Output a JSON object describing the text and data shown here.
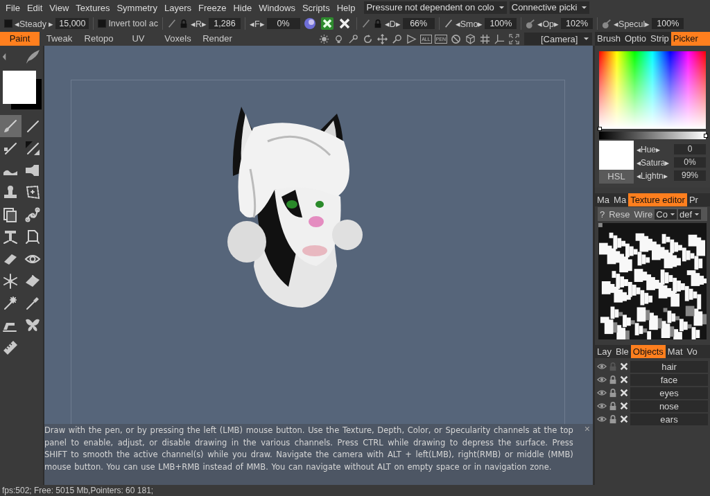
{
  "menu": [
    "File",
    "Edit",
    "View",
    "Textures",
    "Symmetry",
    "Layers",
    "Freeze",
    "Hide",
    "Windows",
    "Scripts",
    "Help"
  ],
  "top_dropdowns": [
    "Pressure not dependent on colo",
    "Connective picki"
  ],
  "toolbar": {
    "steady": {
      "checked": false,
      "label": "◂Steady ▸",
      "value": "15,000"
    },
    "invert": {
      "checked": false,
      "label": "Invert tool ac"
    },
    "radius": {
      "label": "◂R▸",
      "value": "1,286"
    },
    "falloff": {
      "label": "◂F▸",
      "value": "0%"
    },
    "depth": {
      "label": "◂D▸",
      "value": "66%"
    },
    "smooth": {
      "label": "◂Smo▸",
      "value": "100%"
    },
    "opacity": {
      "label": "◂Op▸",
      "value": "102%"
    },
    "specular": {
      "label": "◂Specul▸",
      "value": "100%"
    }
  },
  "mode_tabs": [
    {
      "label": "Paint",
      "selected": true
    },
    {
      "label": "Tweak",
      "selected": false
    },
    {
      "label": "Retopo",
      "selected": false
    },
    {
      "label": "UV",
      "selected": false
    },
    {
      "label": "Voxels",
      "selected": false
    },
    {
      "label": "Render",
      "selected": false
    }
  ],
  "view_tool_labels": [
    "ALL",
    "PEN"
  ],
  "camera_dropdown": "[Camera]",
  "tools": [
    {
      "selected": true
    },
    {
      "selected": false
    },
    {
      "selected": false
    },
    {
      "selected": false
    },
    {
      "selected": false
    },
    {
      "selected": false
    },
    {
      "selected": false
    },
    {
      "selected": false
    },
    {
      "selected": false
    },
    {
      "selected": false
    },
    {
      "selected": false
    },
    {
      "selected": false
    },
    {
      "selected": false
    },
    {
      "selected": false
    },
    {
      "selected": false
    },
    {
      "selected": false
    },
    {
      "selected": false
    },
    {
      "selected": false
    },
    {
      "selected": false
    },
    {
      "selected": false
    },
    {
      "selected": false
    }
  ],
  "hint": "Draw with the pen, or by pressing the left (LMB) mouse button. Use the Texture, Depth, Color, or Specularity channels at the top panel to enable, adjust, or disable drawing in the various channels. Press CTRL while drawing to depress the surface. Press SHIFT to smooth the active channel(s) while you draw. Navigate the camera with ALT + left(LMB), right(RMB)  or middle (MMB) mouse button. You can use LMB+RMB instead of MMB. You can navigate without ALT on empty space or in navigation zone.",
  "hint_close": "×",
  "status_bar": "fps:502;  Free: 5015 Mb,Pointers: 60 181;",
  "panel_tabs": [
    {
      "label": "Brush",
      "selected": false
    },
    {
      "label": "Optio",
      "selected": false
    },
    {
      "label": "Strip",
      "selected": false
    },
    {
      "label": "Picker",
      "selected": true
    }
  ],
  "picker": {
    "mode_button": "HSL",
    "fields": [
      {
        "label": "◂Hue▸",
        "value": "0"
      },
      {
        "label": "◂Satura▸",
        "value": "0%"
      },
      {
        "label": "◂Lightn▸",
        "value": "99%"
      }
    ]
  },
  "texture_tabs": [
    {
      "label": "Ma",
      "selected": false
    },
    {
      "label": "Ma",
      "selected": false
    },
    {
      "label": "Texture editor",
      "selected": true
    },
    {
      "label": "Pr",
      "selected": false
    }
  ],
  "texture_toolbar": {
    "buttons": [
      "?",
      "Rese",
      "Wire"
    ],
    "dropdowns": [
      "Co",
      "def"
    ]
  },
  "layer_tabs": [
    {
      "label": "Lay",
      "selected": false
    },
    {
      "label": "Ble",
      "selected": false
    },
    {
      "label": "Objects",
      "selected": true
    },
    {
      "label": "Mat",
      "selected": false
    },
    {
      "label": "Vo",
      "selected": false
    }
  ],
  "objects": [
    {
      "name": "hair",
      "visible": true,
      "locked": false
    },
    {
      "name": "face",
      "visible": true,
      "locked": true
    },
    {
      "name": "eyes",
      "visible": true,
      "locked": true
    },
    {
      "name": "nose",
      "visible": true,
      "locked": true
    },
    {
      "name": "ears",
      "visible": true,
      "locked": true
    }
  ]
}
